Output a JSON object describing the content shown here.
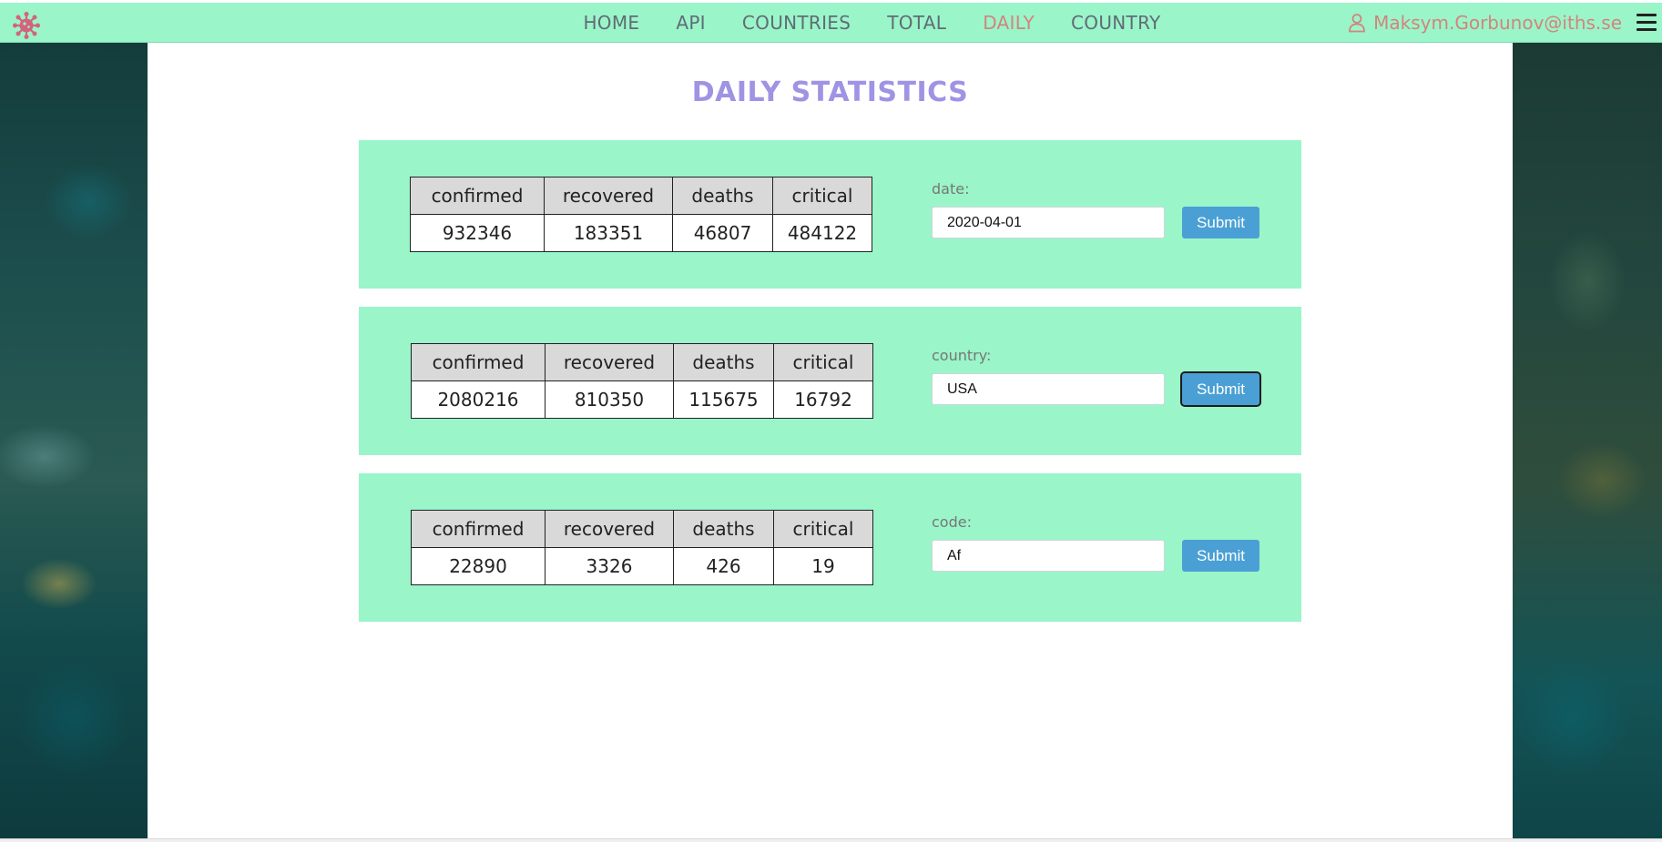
{
  "nav": {
    "links": [
      "HOME",
      "API",
      "COUNTRIES",
      "TOTAL",
      "DAILY",
      "COUNTRY"
    ],
    "active": "DAILY",
    "user": "Maksym.Gorbunov@iths.se",
    "logo_icon": "virus-icon",
    "user_icon": "user-icon",
    "menu_icon": "hamburger-icon"
  },
  "page": {
    "title": "DAILY STATISTICS"
  },
  "headers": [
    "confirmed",
    "recovered",
    "deaths",
    "critical"
  ],
  "cards": [
    {
      "label": "date:",
      "value": "2020-04-01",
      "submit": "Submit",
      "row": [
        "932346",
        "183351",
        "46807",
        "484122"
      ]
    },
    {
      "label": "country:",
      "value": "USA",
      "submit": "Submit",
      "row": [
        "2080216",
        "810350",
        "115675",
        "16792"
      ]
    },
    {
      "label": "code:",
      "value": "Af",
      "submit": "Submit",
      "row": [
        "22890",
        "3326",
        "426",
        "19"
      ]
    }
  ],
  "colors": {
    "nav_bg": "#9af5c9",
    "active": "#d3847d",
    "title": "#9f93e4",
    "card_bg": "#9af5c9",
    "button": "#4aa0d4"
  }
}
